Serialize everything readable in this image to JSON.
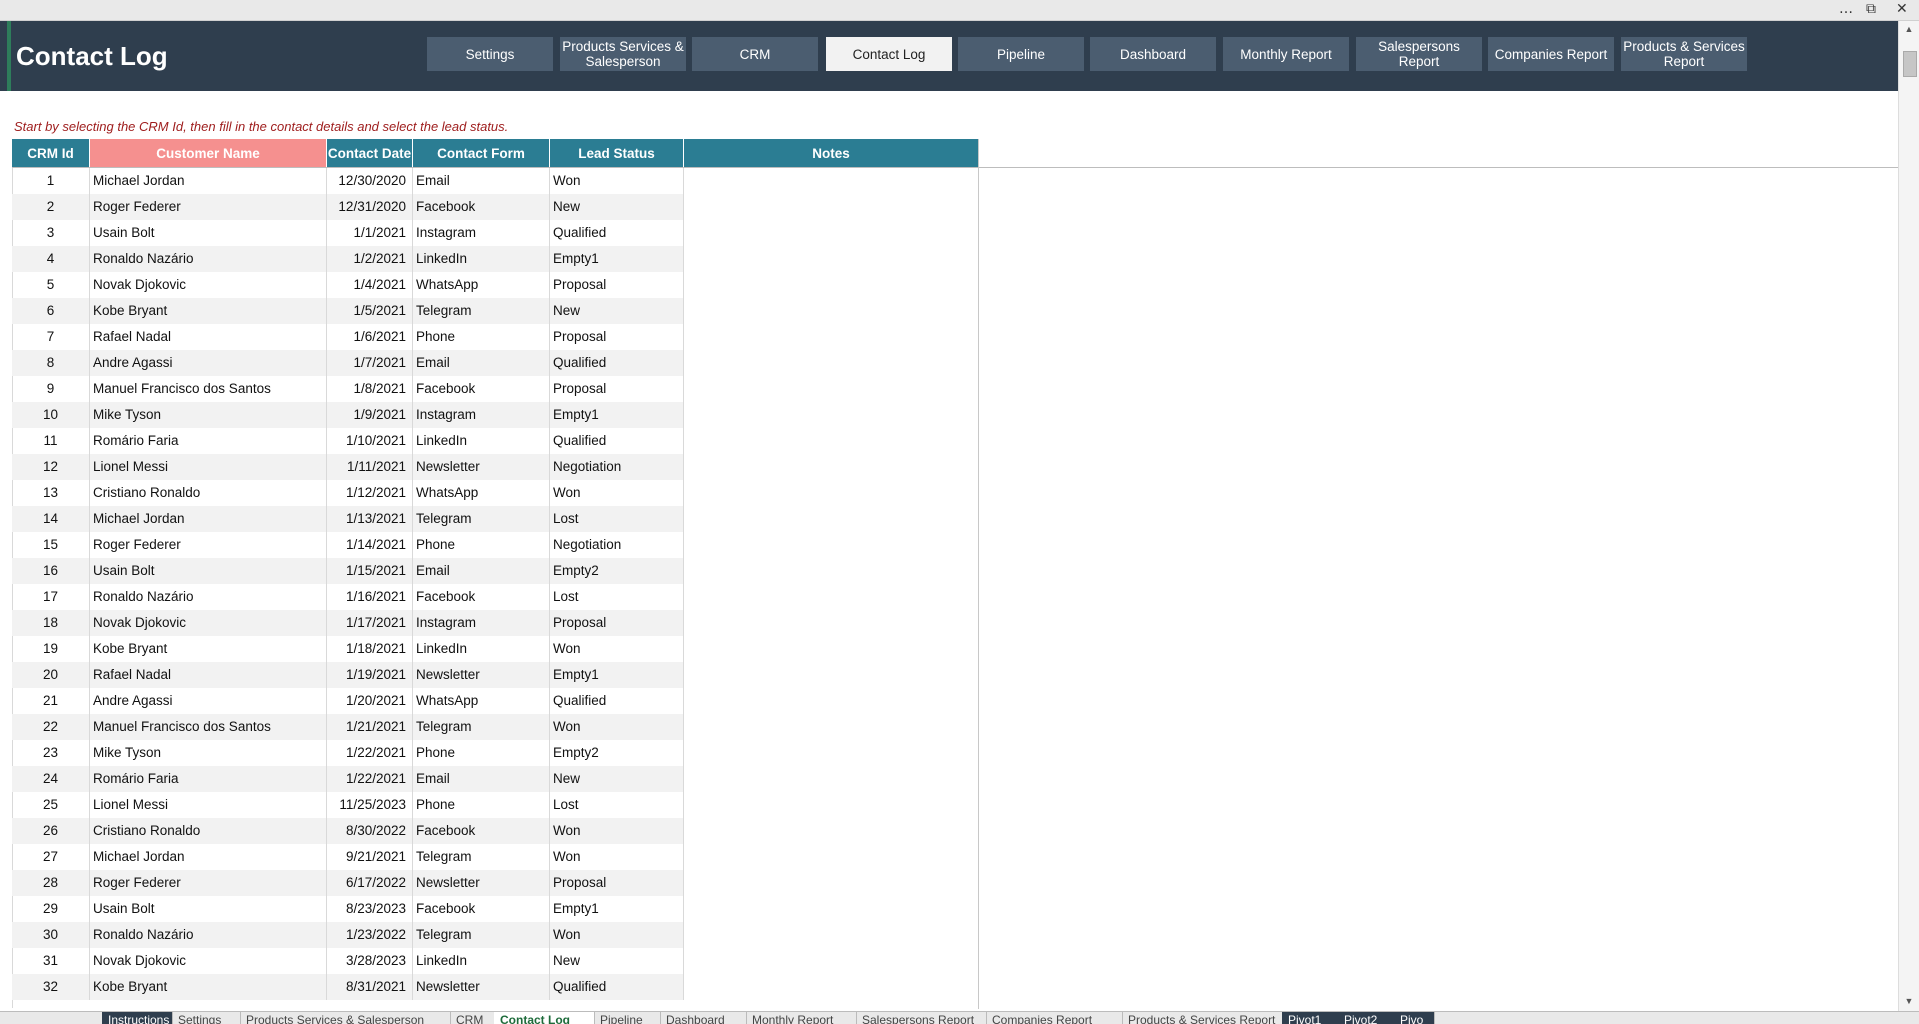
{
  "window": {
    "more_icon": "…",
    "restore_icon": "⧉",
    "close_icon": "✕"
  },
  "header": {
    "title": "Contact Log",
    "nav": [
      {
        "label": "Settings",
        "active": false
      },
      {
        "label": "Products Services & Salesperson",
        "active": false
      },
      {
        "label": "CRM",
        "active": false
      },
      {
        "label": "Contact Log",
        "active": true
      },
      {
        "label": "Pipeline",
        "active": false
      },
      {
        "label": "Dashboard",
        "active": false
      },
      {
        "label": "Monthly Report",
        "active": false
      },
      {
        "label": "Salespersons Report",
        "active": false
      },
      {
        "label": "Companies Report",
        "active": false
      },
      {
        "label": "Products & Services Report",
        "active": false
      }
    ]
  },
  "instruction": "Start by selecting the CRM Id, then fill in the contact details and select the lead status.",
  "table": {
    "columns": [
      "CRM Id",
      "Customer Name",
      "Contact Date",
      "Contact Form",
      "Lead Status",
      "Notes"
    ],
    "rows": [
      [
        "1",
        "Michael Jordan",
        "12/30/2020",
        "Email",
        "Won"
      ],
      [
        "2",
        "Roger Federer",
        "12/31/2020",
        "Facebook",
        "New"
      ],
      [
        "3",
        "Usain Bolt",
        "1/1/2021",
        "Instagram",
        "Qualified"
      ],
      [
        "4",
        "Ronaldo Nazário",
        "1/2/2021",
        "LinkedIn",
        "Empty1"
      ],
      [
        "5",
        "Novak Djokovic",
        "1/4/2021",
        "WhatsApp",
        "Proposal"
      ],
      [
        "6",
        "Kobe Bryant",
        "1/5/2021",
        "Telegram",
        "New"
      ],
      [
        "7",
        "Rafael Nadal",
        "1/6/2021",
        "Phone",
        "Proposal"
      ],
      [
        "8",
        "Andre Agassi",
        "1/7/2021",
        "Email",
        "Qualified"
      ],
      [
        "9",
        "Manuel Francisco dos Santos",
        "1/8/2021",
        "Facebook",
        "Proposal"
      ],
      [
        "10",
        "Mike Tyson",
        "1/9/2021",
        "Instagram",
        "Empty1"
      ],
      [
        "11",
        "Romário Faria",
        "1/10/2021",
        "LinkedIn",
        "Qualified"
      ],
      [
        "12",
        "Lionel Messi",
        "1/11/2021",
        "Newsletter",
        "Negotiation"
      ],
      [
        "13",
        "Cristiano Ronaldo",
        "1/12/2021",
        "WhatsApp",
        "Won"
      ],
      [
        "14",
        "Michael Jordan",
        "1/13/2021",
        "Telegram",
        "Lost"
      ],
      [
        "15",
        "Roger Federer",
        "1/14/2021",
        "Phone",
        "Negotiation"
      ],
      [
        "16",
        "Usain Bolt",
        "1/15/2021",
        "Email",
        "Empty2"
      ],
      [
        "17",
        "Ronaldo Nazário",
        "1/16/2021",
        "Facebook",
        "Lost"
      ],
      [
        "18",
        "Novak Djokovic",
        "1/17/2021",
        "Instagram",
        "Proposal"
      ],
      [
        "19",
        "Kobe Bryant",
        "1/18/2021",
        "LinkedIn",
        "Won"
      ],
      [
        "20",
        "Rafael Nadal",
        "1/19/2021",
        "Newsletter",
        "Empty1"
      ],
      [
        "21",
        "Andre Agassi",
        "1/20/2021",
        "WhatsApp",
        "Qualified"
      ],
      [
        "22",
        "Manuel Francisco dos Santos",
        "1/21/2021",
        "Telegram",
        "Won"
      ],
      [
        "23",
        "Mike Tyson",
        "1/22/2021",
        "Phone",
        "Empty2"
      ],
      [
        "24",
        "Romário Faria",
        "1/22/2021",
        "Email",
        "New"
      ],
      [
        "25",
        "Lionel Messi",
        "11/25/2023",
        "Phone",
        "Lost"
      ],
      [
        "26",
        "Cristiano Ronaldo",
        "8/30/2022",
        "Facebook",
        "Won"
      ],
      [
        "27",
        "Michael Jordan",
        "9/21/2021",
        "Telegram",
        "Won"
      ],
      [
        "28",
        "Roger Federer",
        "6/17/2022",
        "Newsletter",
        "Proposal"
      ],
      [
        "29",
        "Usain Bolt",
        "8/23/2023",
        "Facebook",
        "Empty1"
      ],
      [
        "30",
        "Ronaldo Nazário",
        "1/23/2022",
        "Telegram",
        "Won"
      ],
      [
        "31",
        "Novak Djokovic",
        "3/28/2023",
        "LinkedIn",
        "New"
      ],
      [
        "32",
        "Kobe Bryant",
        "8/31/2021",
        "Newsletter",
        "Qualified"
      ]
    ]
  },
  "sheet_tabs": [
    {
      "label": "Instructions",
      "style": "dark"
    },
    {
      "label": "Settings",
      "style": "normal"
    },
    {
      "label": "Products Services & Salesperson",
      "style": "normal"
    },
    {
      "label": "CRM",
      "style": "normal"
    },
    {
      "label": "Contact Log",
      "style": "active"
    },
    {
      "label": "Pipeline",
      "style": "normal"
    },
    {
      "label": "Dashboard",
      "style": "normal"
    },
    {
      "label": "Monthly Report",
      "style": "normal"
    },
    {
      "label": "Salespersons Report",
      "style": "normal"
    },
    {
      "label": "Companies Report",
      "style": "normal"
    },
    {
      "label": "Products & Services Report",
      "style": "normal"
    },
    {
      "label": "Pivot1",
      "style": "dark"
    },
    {
      "label": "Pivot2",
      "style": "dark"
    },
    {
      "label": "Pivo",
      "style": "dark"
    }
  ],
  "colors": {
    "header_bg": "#2f3e4e",
    "nav_bg": "#4b5d70",
    "table_header": "#2b7d93",
    "customer_header": "#f5908f",
    "instruction_text": "#9e1c1c"
  }
}
